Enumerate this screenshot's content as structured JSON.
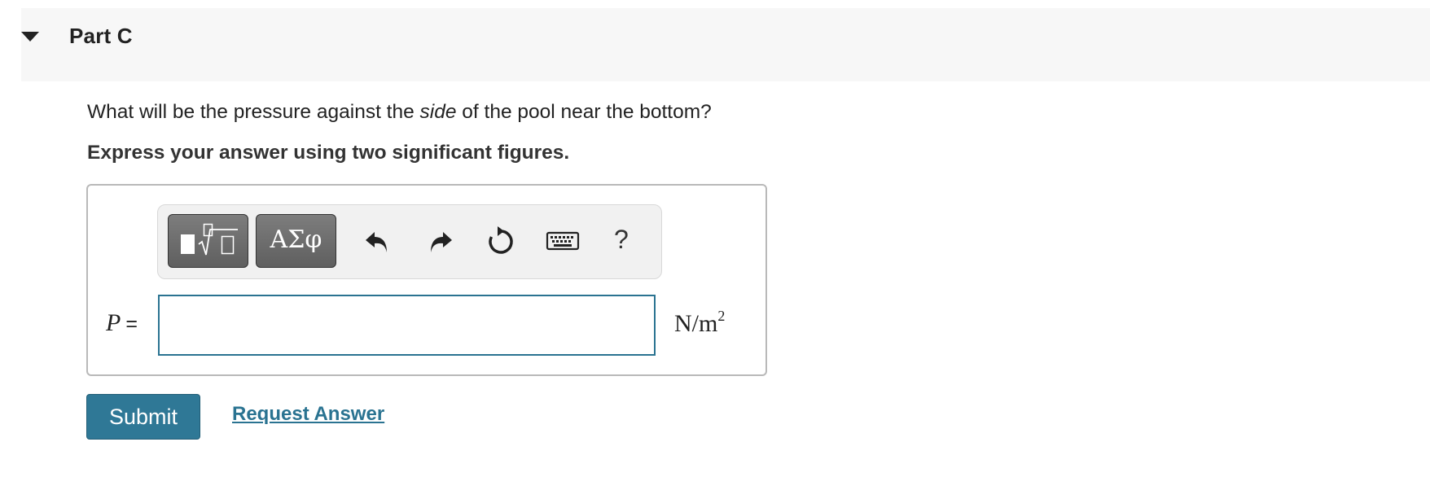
{
  "part": {
    "title": "Part C"
  },
  "question": {
    "text_before": "What will be the pressure against the ",
    "text_emphasis": "side",
    "text_after": " of the pool near the bottom?",
    "instruction": "Express your answer using two significant figures."
  },
  "toolbar": {
    "templates_icon": "math-templates-icon",
    "symbols_label": "ΑΣφ",
    "undo_icon": "undo-icon",
    "redo_icon": "redo-icon",
    "reset_icon": "reset-icon",
    "keyboard_icon": "keyboard-icon",
    "help_label": "?"
  },
  "answer": {
    "variable": "P",
    "equals": "=",
    "value": "",
    "units_base": "N/m",
    "units_exponent": "2"
  },
  "actions": {
    "submit_label": "Submit",
    "request_answer_label": "Request Answer"
  },
  "colors": {
    "accent": "#2f7896",
    "link": "#2a7391",
    "header_bg": "#f7f7f7"
  }
}
